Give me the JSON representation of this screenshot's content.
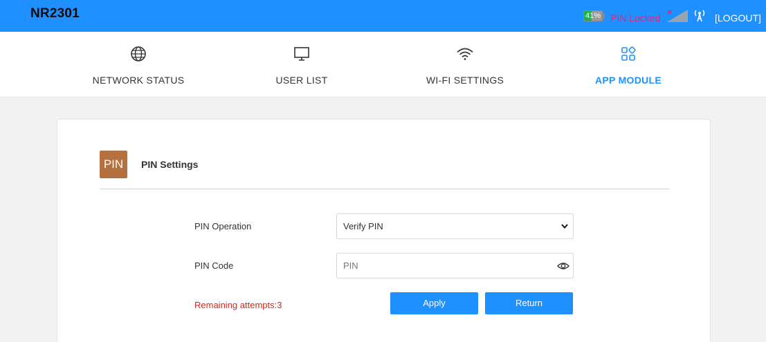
{
  "header": {
    "brand": "NR2301",
    "battery_percent": "41%",
    "battery_level": 0.41,
    "battery_color": "#22b14c",
    "pin_status": "PIN Locked",
    "signal_icon": "signal-no-service-icon",
    "antenna_icon": "antenna-icon",
    "logout_label": "[LOGOUT]",
    "accent_color": "#1e90ff"
  },
  "nav": {
    "items": [
      {
        "label": "NETWORK STATUS",
        "icon": "globe-icon"
      },
      {
        "label": "USER LIST",
        "icon": "monitor-icon"
      },
      {
        "label": "WI-FI SETTINGS",
        "icon": "wifi-icon"
      },
      {
        "label": "APP MODULE",
        "icon": "app-grid-icon",
        "active": true
      }
    ]
  },
  "card": {
    "badge": "PIN",
    "badge_color": "#b5703f",
    "title": "PIN Settings",
    "pin_operation_label": "PIN Operation",
    "pin_operation_value": "Verify PIN",
    "pin_code_label": "PIN Code",
    "pin_code_placeholder": "PIN",
    "remaining_attempts": "Remaining attempts:3",
    "apply_label": "Apply",
    "return_label": "Return"
  }
}
